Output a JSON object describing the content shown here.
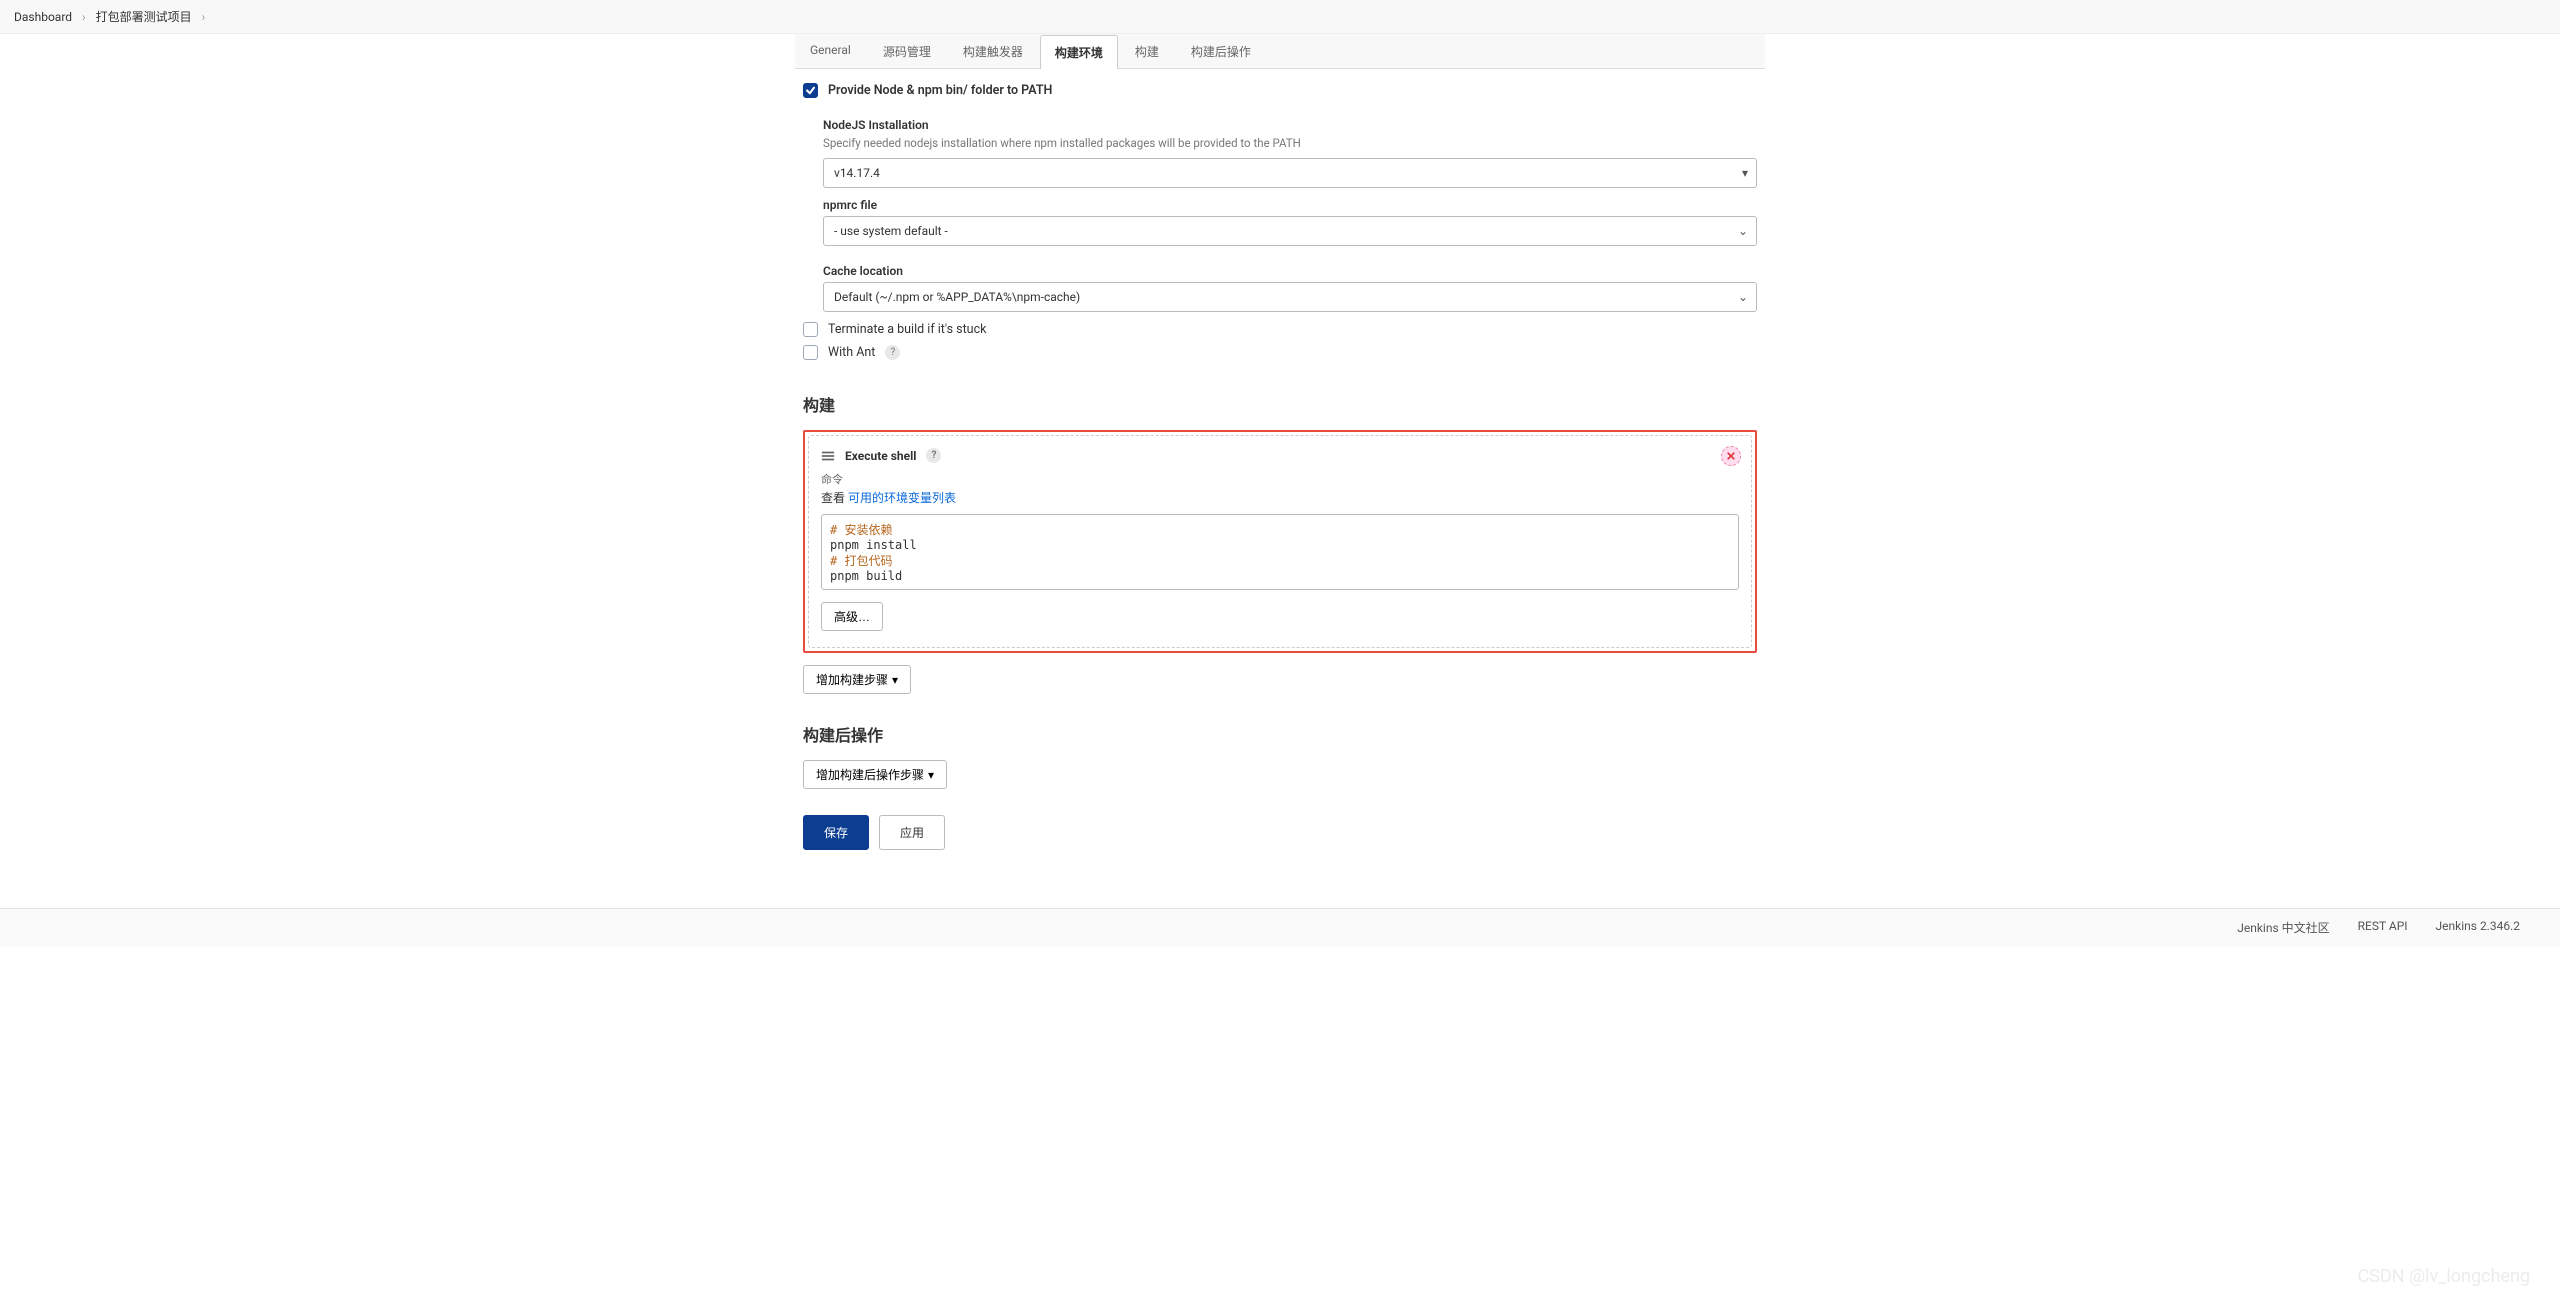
{
  "breadcrumb": {
    "items": [
      "Dashboard",
      "打包部署测试项目"
    ]
  },
  "tabs": [
    {
      "id": "general",
      "label": "General"
    },
    {
      "id": "scm",
      "label": "源码管理"
    },
    {
      "id": "triggers",
      "label": "构建触发器"
    },
    {
      "id": "env",
      "label": "构建环境"
    },
    {
      "id": "build",
      "label": "构建"
    },
    {
      "id": "post",
      "label": "构建后操作"
    }
  ],
  "active_tab": "env",
  "env": {
    "provide_node": {
      "label": "Provide Node & npm bin/ folder to PATH",
      "checked": true
    },
    "nodejs_install": {
      "label": "NodeJS Installation",
      "desc": "Specify needed nodejs installation where npm installed packages will be provided to the PATH",
      "value": "v14.17.4"
    },
    "npmrc": {
      "label": "npmrc file",
      "value": "- use system default -"
    },
    "cache": {
      "label": "Cache location",
      "value": "Default (~/.npm or %APP_DATA%\\npm-cache)"
    },
    "terminate": {
      "label": "Terminate a build if it's stuck",
      "checked": false
    },
    "with_ant": {
      "label": "With Ant",
      "checked": false
    }
  },
  "build": {
    "title": "构建",
    "step": {
      "title": "Execute shell",
      "cmd_label": "命令",
      "see_text": "查看 ",
      "link_text": "可用的环境变量列表",
      "code": {
        "line1_comment": "# 安装依赖",
        "line1": "pnpm install",
        "line2_comment": "# 打包代码",
        "line2": "pnpm build"
      },
      "advanced_btn": "高级…"
    },
    "add_step_btn": "增加构建步骤"
  },
  "post": {
    "title": "构建后操作",
    "add_btn": "增加构建后操作步骤"
  },
  "buttons": {
    "save": "保存",
    "apply": "应用"
  },
  "footer": {
    "items": [
      "Jenkins 中文社区",
      "REST API",
      "Jenkins 2.346.2"
    ]
  },
  "watermark": "CSDN @lv_longcheng"
}
